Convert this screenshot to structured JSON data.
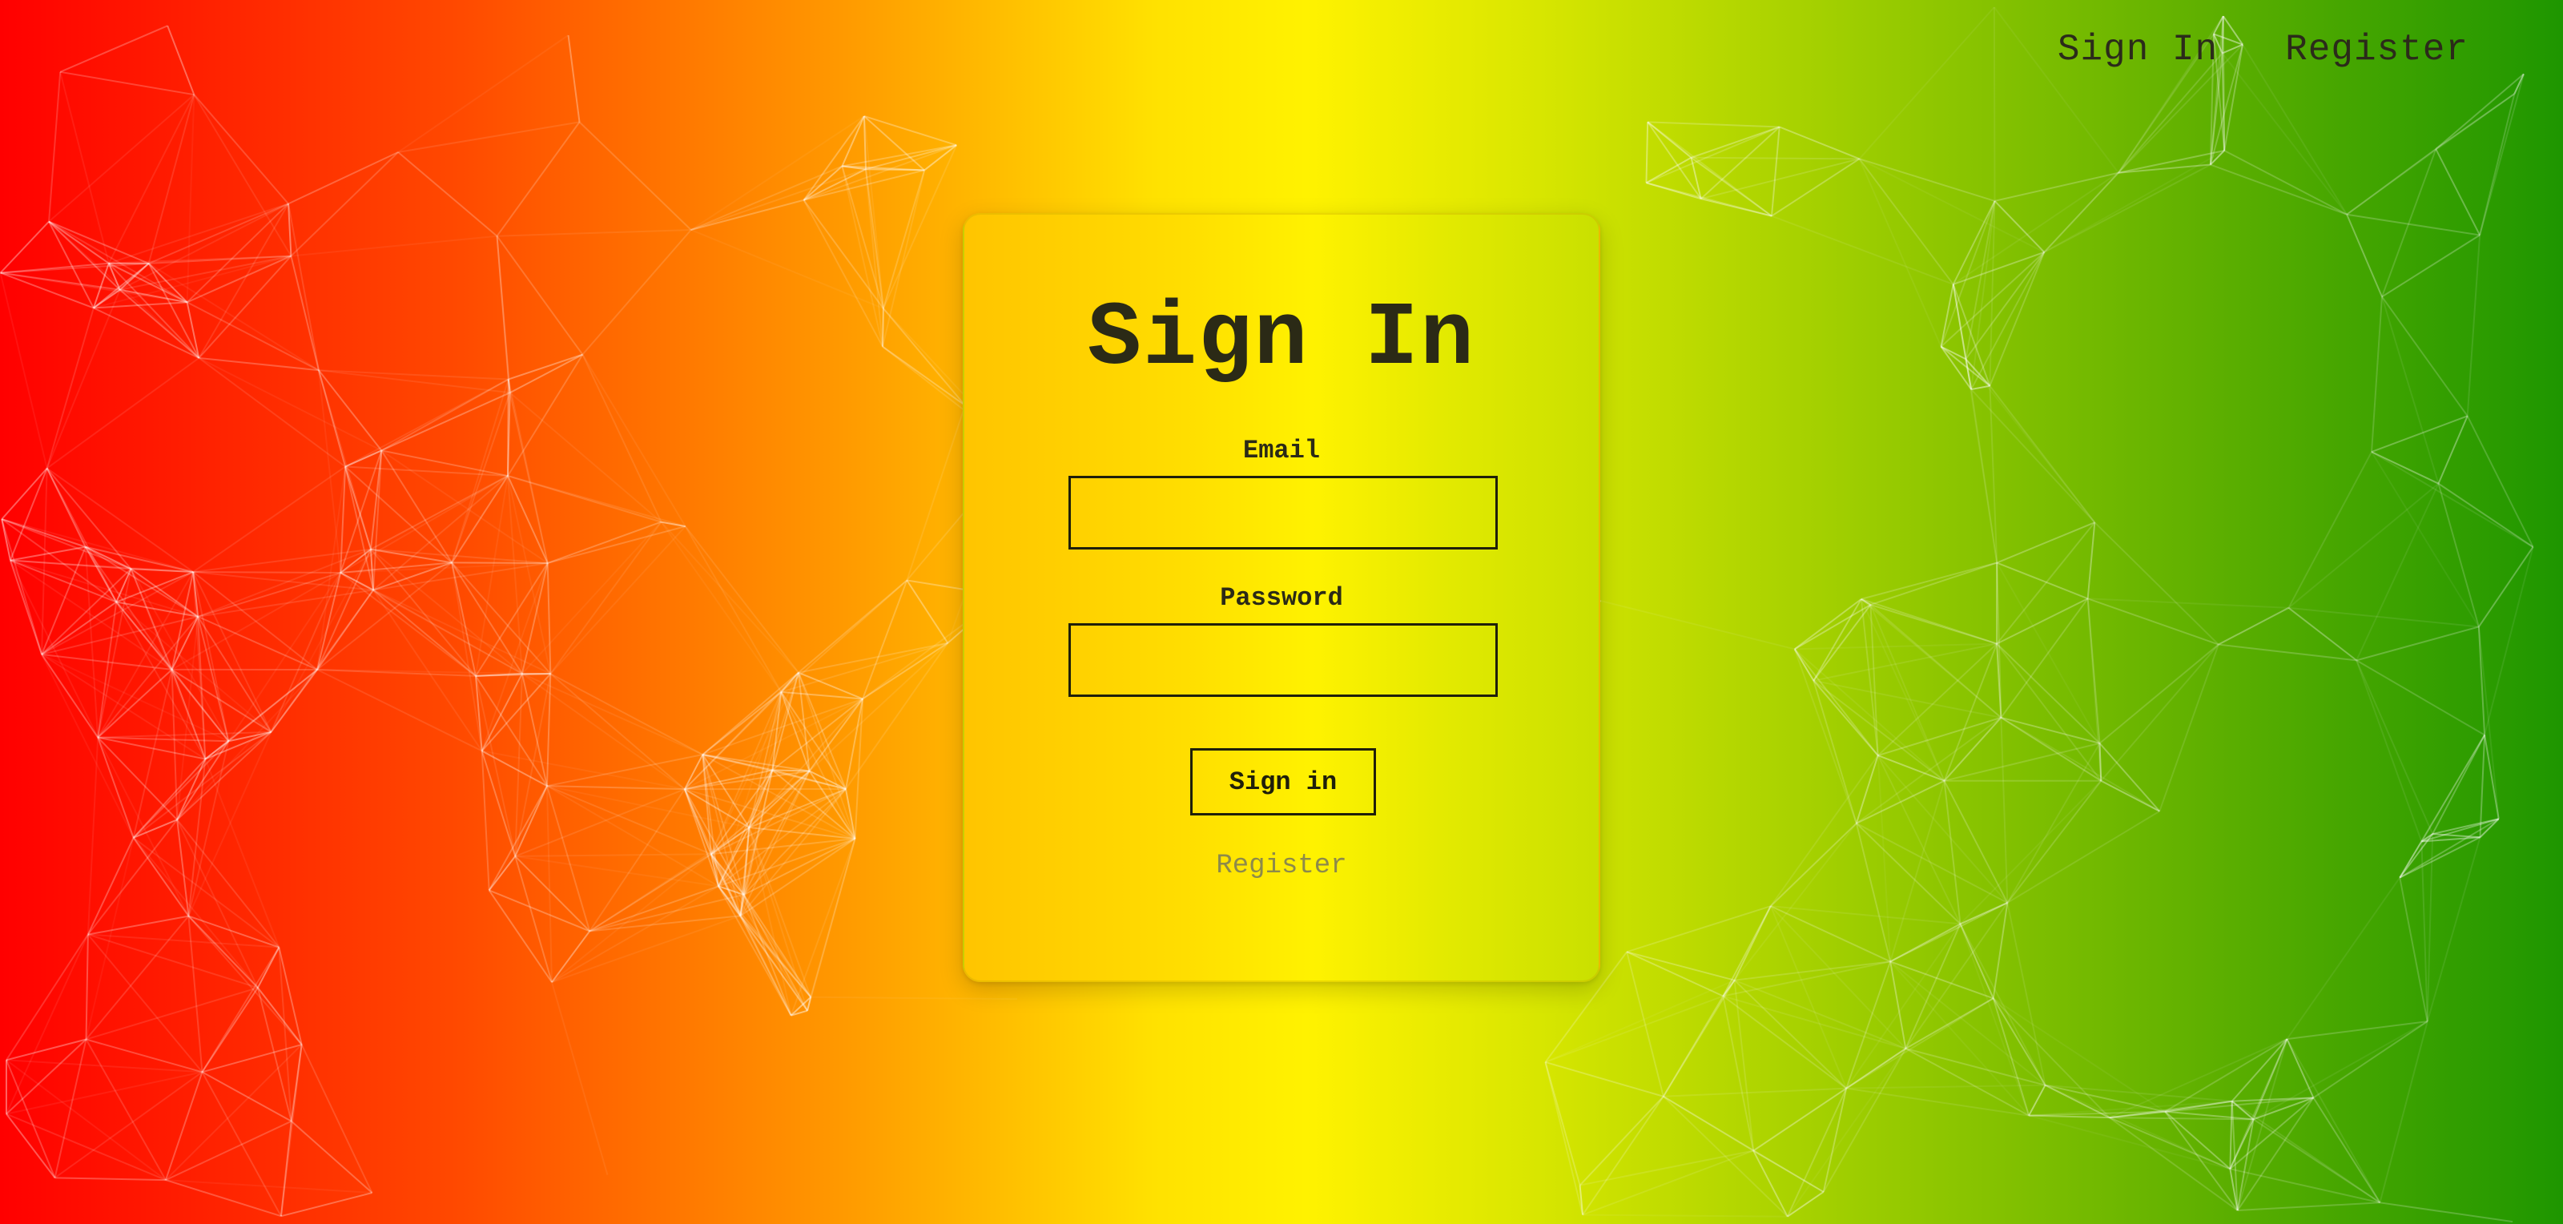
{
  "nav": {
    "signin_label": "Sign In",
    "register_label": "Register"
  },
  "card": {
    "title": "Sign In",
    "email_label": "Email",
    "email_value": "",
    "password_label": "Password",
    "password_value": "",
    "submit_label": "Sign in",
    "register_link": "Register"
  },
  "colors": {
    "gradient_start": "#ff0000",
    "gradient_mid": "#fff200",
    "gradient_end": "#1e9600",
    "text_dark": "#2b2a16",
    "link_muted": "#8d8a4a"
  }
}
